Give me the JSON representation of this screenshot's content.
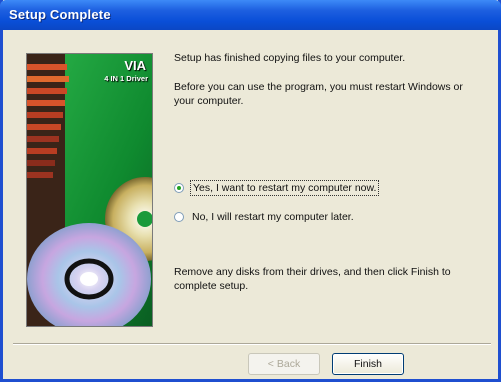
{
  "window": {
    "title": "Setup Complete"
  },
  "banner": {
    "brand": "VIA",
    "subtitle": "4 IN 1 Driver"
  },
  "content": {
    "line1": "Setup has finished copying files to your computer.",
    "line2": "Before you can use the program, you must restart Windows or your computer.",
    "option_yes": "Yes, I want to restart my computer now.",
    "option_no": "No, I will restart my computer later.",
    "selected_option": "yes",
    "line3": "Remove any disks from their drives, and then click Finish to complete setup."
  },
  "buttons": {
    "back": "< Back",
    "finish": "Finish"
  },
  "colors": {
    "titlebar": "#0a4fd8",
    "window_bg": "#ece9d8",
    "banner_green": "#1a9a3a"
  }
}
